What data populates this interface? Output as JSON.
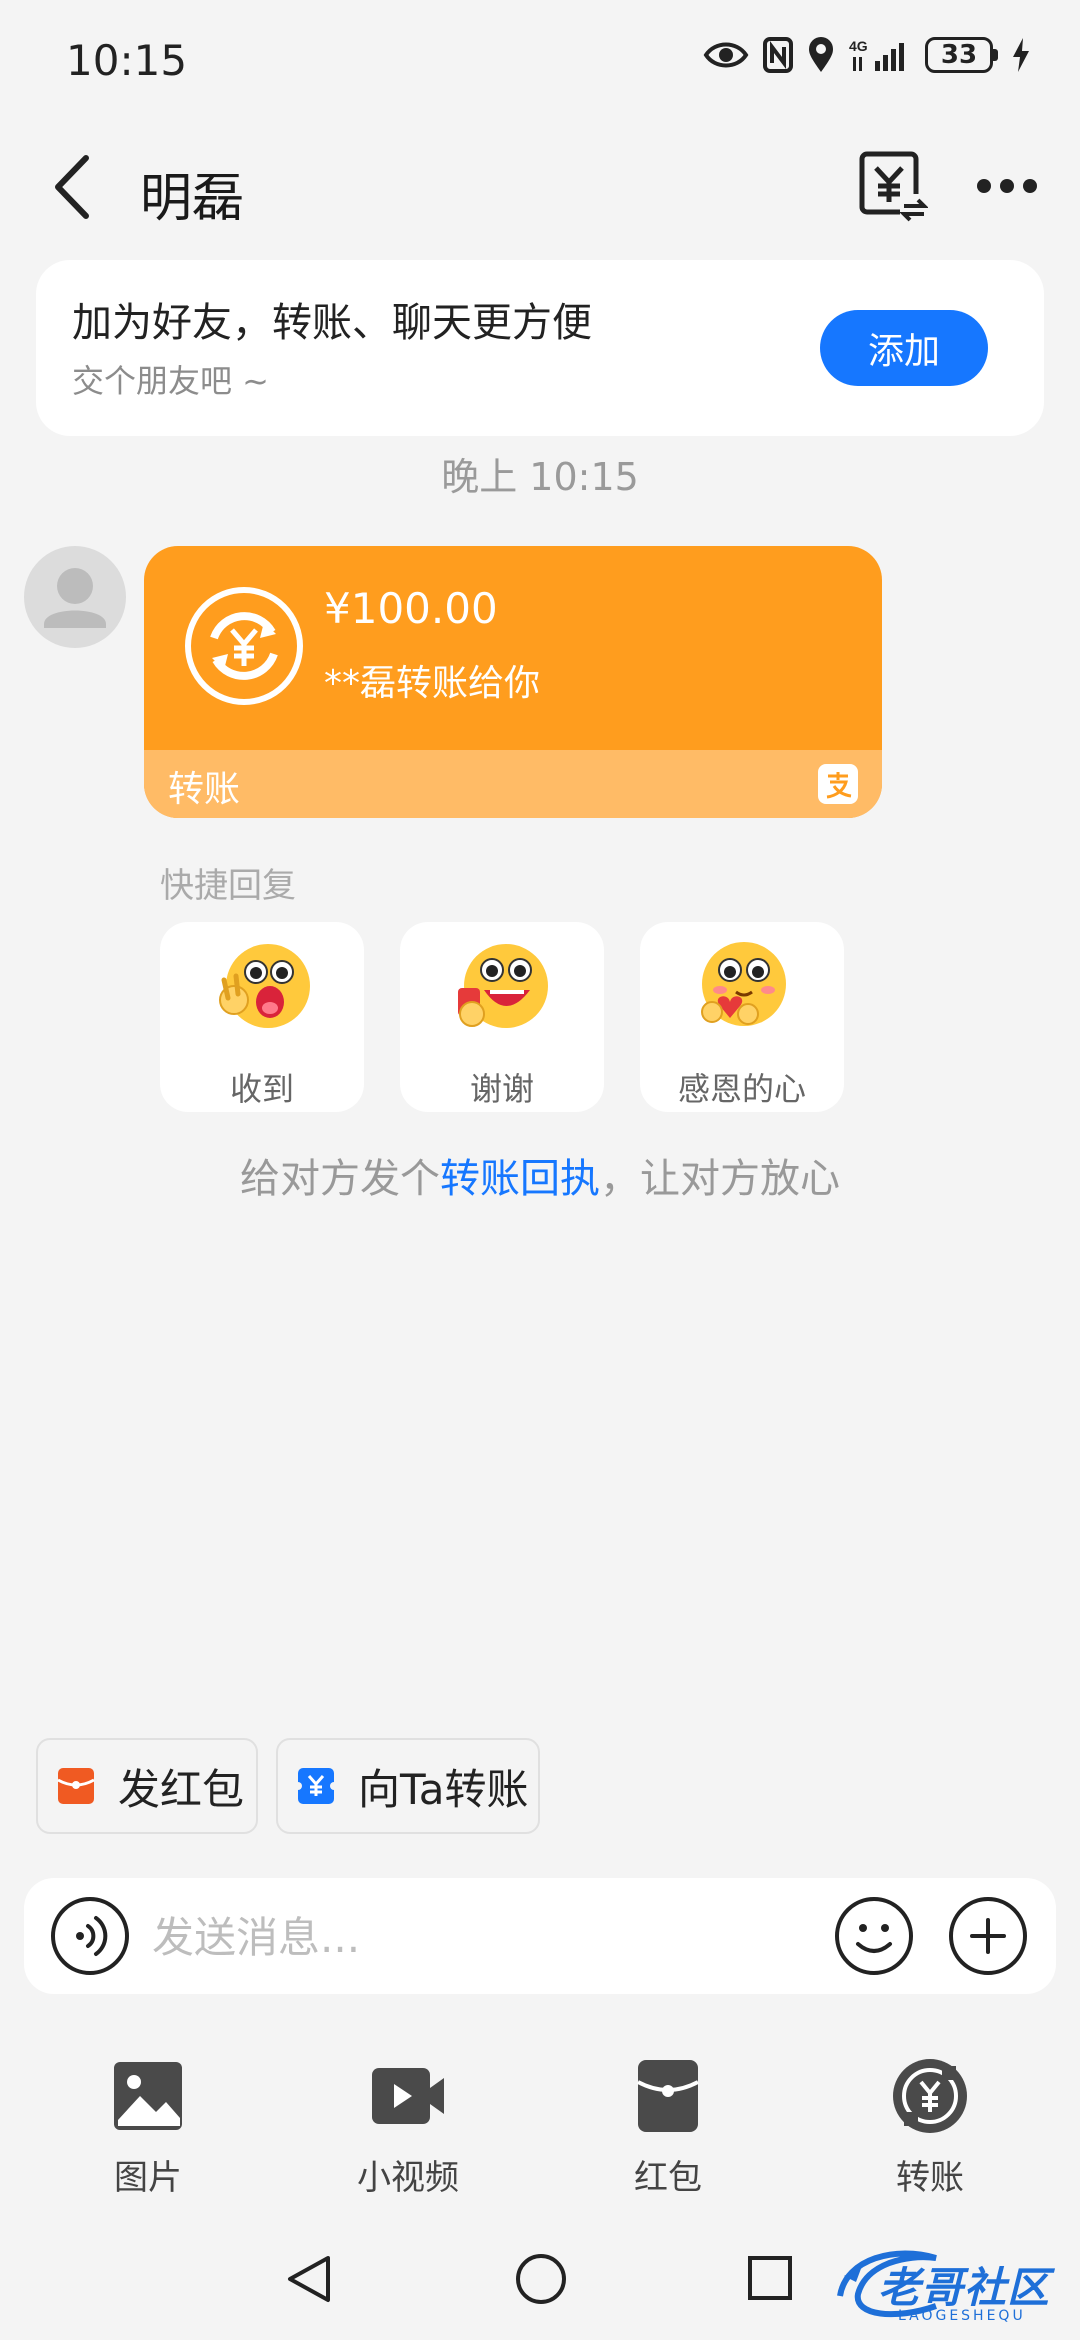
{
  "status_bar": {
    "time": "10:15",
    "network": "4G",
    "battery": "33"
  },
  "header": {
    "title": "明磊",
    "icons": [
      "back-arrow-icon",
      "transfer-yuan-icon",
      "more-icon"
    ]
  },
  "friend_card": {
    "title": "加为好友，转账、聊天更方便",
    "subtitle": "交个朋友吧 ~",
    "add_label": "添加"
  },
  "timestamp": "晚上 10:15",
  "message": {
    "amount": "¥100.00",
    "description": "**磊转账给你",
    "type_label": "转账"
  },
  "quick_reply": {
    "label": "快捷回复",
    "items": [
      {
        "label": "收到"
      },
      {
        "label": "谢谢"
      },
      {
        "label": "感恩的心"
      }
    ]
  },
  "receipt": {
    "prefix": "给对方发个",
    "link": "转账回执",
    "suffix": "，让对方放心"
  },
  "shortcuts": {
    "red_packet": "发红包",
    "transfer": "向Ta转账"
  },
  "input": {
    "placeholder": "发送消息..."
  },
  "tools": [
    {
      "label": "图片",
      "icon": "image-icon"
    },
    {
      "label": "小视频",
      "icon": "video-icon"
    },
    {
      "label": "红包",
      "icon": "red-packet-icon"
    },
    {
      "label": "转账",
      "icon": "transfer-icon"
    }
  ],
  "watermark": {
    "text": "老哥社区",
    "sub": "LAOGESHEQU"
  },
  "colors": {
    "accent": "#1677ff",
    "bubble": "#ff9d1e",
    "bubble_footer": "#ffbb66",
    "background": "#f4f4f4"
  }
}
